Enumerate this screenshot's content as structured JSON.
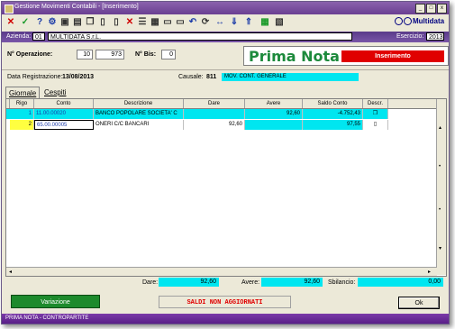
{
  "window": {
    "title": "Gestione Movimenti Contabili - [Inserimento]"
  },
  "toolbar": {
    "logo_text": "Multidata"
  },
  "azienda": {
    "label": "Azienda:",
    "code": "01",
    "name": "MULTIDATA S.r.L.",
    "esercizio_label": "Esercizio:",
    "esercizio": "2013"
  },
  "header": {
    "operazione_label": "N° Operazione:",
    "operazione_a": "10",
    "operazione_b": "973",
    "bis_label": "N° Bis:",
    "bis": "0",
    "primanota_title": "Prima Nota",
    "mode": "Inserimento",
    "data_label": "Data Registrazione:",
    "data": "13/08/2013",
    "causale_label": "Causale:",
    "causale_code": "811",
    "causale_desc": "MOV. CONT. GENERALE"
  },
  "tabs": [
    {
      "label": "Giornale"
    },
    {
      "label": "Cespiti"
    }
  ],
  "grid": {
    "columns": [
      "Rigo",
      "Conto",
      "Descrizione",
      "Dare",
      "Avere",
      "Saldo Conto",
      "Descr."
    ],
    "rows": [
      {
        "rigo": "1",
        "conto": "11.00.00020",
        "descrizione": "BANCO POPOLARE SOCIETA' C",
        "dare": "",
        "avere": "92,60",
        "saldo": "-4.752,43"
      },
      {
        "rigo": "2",
        "conto": "65.00.00005",
        "descrizione": "ONERI C/C BANCARI",
        "dare": "92,60",
        "avere": "",
        "saldo": "97,55"
      }
    ]
  },
  "totals": {
    "dare_label": "Dare:",
    "dare": "92,60",
    "avere_label": "Avere:",
    "avere": "92,60",
    "sbilancio_label": "Sbilancio:",
    "sbilancio": "0,00"
  },
  "buttons": {
    "variazione": "Variazione",
    "saldi": "SALDI NON AGGIORNATI",
    "ok": "Ok"
  },
  "status": {
    "text": "PRIMA NOTA - CONTROPARTITE"
  },
  "colors": {
    "accent": "#6a3f92",
    "highlight": "#00e6f0",
    "green": "#1d8a2c",
    "red": "#e00000"
  }
}
